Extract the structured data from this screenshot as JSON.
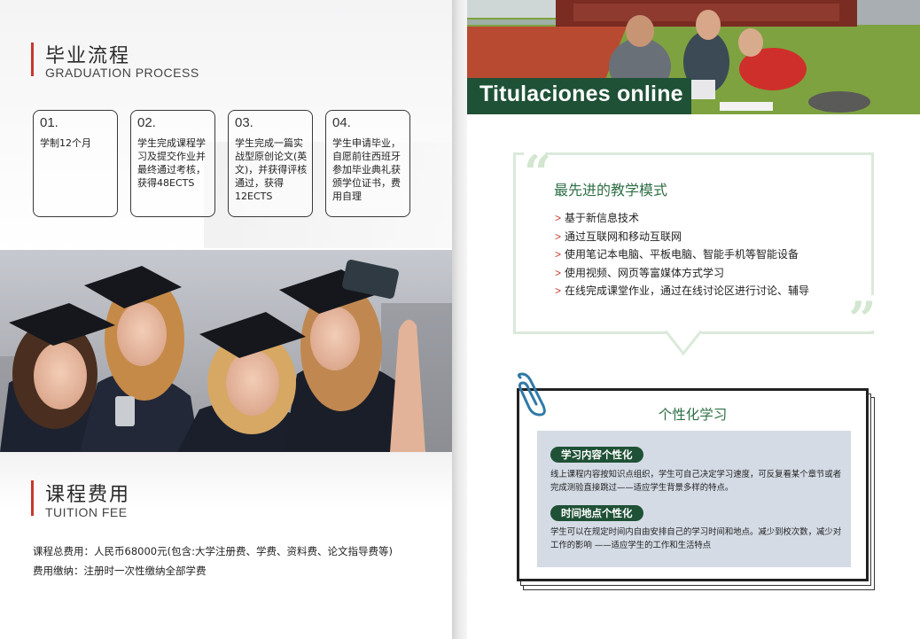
{
  "left": {
    "graduation": {
      "title": "毕业流程",
      "subtitle": "GRADUATION PROCESS",
      "steps": [
        {
          "num": "01.",
          "text": "学制12个月"
        },
        {
          "num": "02.",
          "text": "学生完成课程学习及提交作业并最终通过考核，获得48ECTS"
        },
        {
          "num": "03.",
          "text": "学生完成一篇实战型原创论文(英文)，并获得评核通过，获得12ECTS"
        },
        {
          "num": "04.",
          "text": "学生申请毕业，自愿前往西班牙参加毕业典礼获颁学位证书，费用自理"
        }
      ]
    },
    "tuition": {
      "title": "课程费用",
      "subtitle": "TUITION FEE",
      "line1": "课程总费用：人民币68000元(包含:大学注册费、学费、资料费、论文指导费等)",
      "line2": "费用缴纳：注册时一次性缴纳全部学费"
    }
  },
  "right": {
    "banner_title": "Titulaciones online",
    "teaching": {
      "title": "最先进的教学模式",
      "bullet_marker": ">",
      "items": [
        "基于新信息技术",
        "通过互联网和移动互联网",
        "使用笔记本电脑、平板电脑、智能手机等智能设备",
        "使用视频、网页等富媒体方式学习",
        "在线完成课堂作业，通过在线讨论区进行讨论、辅导"
      ]
    },
    "personal": {
      "title": "个性化学习",
      "sections": [
        {
          "label": "学习内容个性化",
          "text_lines": [
            "线上课程内容按知识点组织，学生可自己决定学习速度，可反复看某个章节或者",
            "完成测验直接跳过——适应学生背景多样的特点。"
          ]
        },
        {
          "label": "时间地点个性化",
          "text_lines": [
            "学生可以在规定时间内自由安排自己的学习时间和地点。减少到校次数，减少对",
            "工作的影响 ——适应学生的工作和生活特点"
          ]
        }
      ]
    }
  },
  "colors": {
    "accent_red": "#c8372d",
    "brand_green": "#1f5136",
    "title_green": "#2e6e45",
    "quote_green": "#d2e6d0",
    "inner_panel": "#d4dbe5"
  },
  "icons": {
    "quote_open": "“",
    "quote_close": "”",
    "paperclip": "paperclip-icon"
  }
}
